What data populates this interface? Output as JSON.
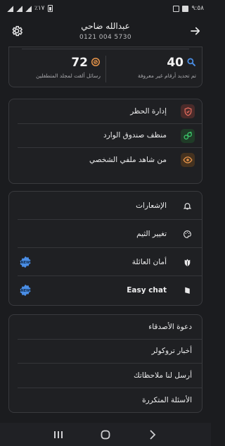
{
  "status": {
    "time": "٩:٥٨",
    "battery": "٪١٧"
  },
  "header": {
    "name": "عبدالله ضاحي",
    "phone": "0121 004 5730"
  },
  "stats": {
    "identified": {
      "value": "40",
      "label": "تم تحديد أرقام غير معروفة"
    },
    "spam": {
      "value": "72",
      "label": "رسائل ألقت لمجلد المتطفلين"
    }
  },
  "security": [
    {
      "label": "إدارة الحظر",
      "color": "#e06a5c",
      "bg": "#4a2b2a"
    },
    {
      "label": "منظف صندوق الوارد",
      "color": "#3cc76b",
      "bg": "#1f3b27"
    },
    {
      "label": "من شاهد ملفي الشخصي",
      "color": "#e6944a",
      "bg": "#45321f"
    }
  ],
  "features": [
    {
      "label": "الإشعارات",
      "badge": ""
    },
    {
      "label": "تغيير الثيم",
      "badge": ""
    },
    {
      "label": "أمان العائلة",
      "badge": "NEW"
    },
    {
      "label": "Easy chat",
      "badge": "NEW"
    }
  ],
  "misc": [
    {
      "label": "دعوة الأصدقاء"
    },
    {
      "label": "أخبار تروكولر"
    },
    {
      "label": "أرسل لنا ملاحظاتك"
    },
    {
      "label": "الأسئلة المتكررة"
    }
  ],
  "accent": "#4a8ee6",
  "icons": {
    "settings": "gear-icon",
    "back": "arrow-right-icon",
    "identified": "search-icon",
    "spam": "blocked-chat-icon",
    "block": "shield-icon",
    "inbox": "broom-icon",
    "profile": "eye-icon",
    "notifications": "bell-icon",
    "theme": "palette-icon",
    "family": "leaf-shield-icon",
    "chat": "chat-icon"
  }
}
